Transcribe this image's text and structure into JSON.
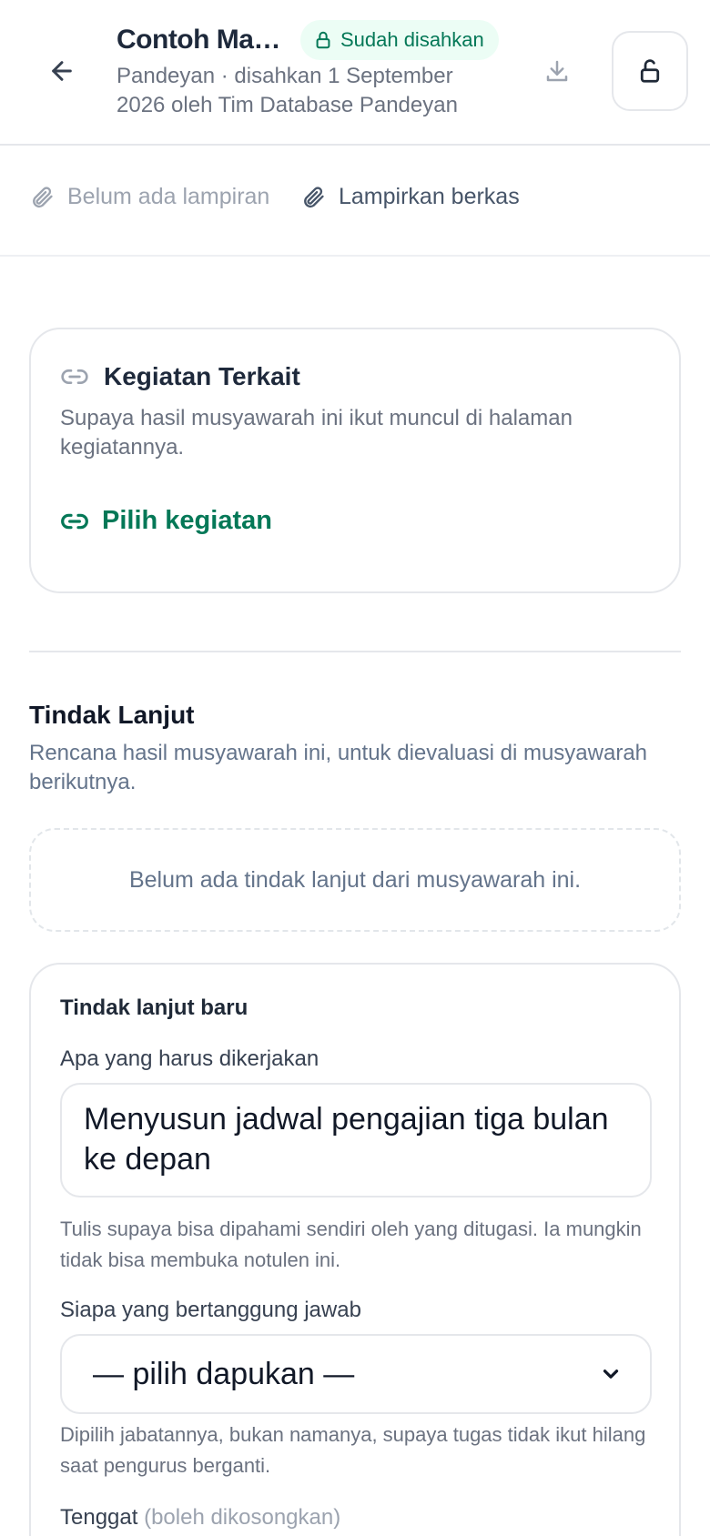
{
  "header": {
    "title": "Contoh Ma…",
    "status_badge": "Sudah disahkan",
    "subtitle": "Pandeyan · disahkan 1 September 2026 oleh Tim Database Pandeyan",
    "icons": {
      "back": "arrow-left-icon",
      "badge": "lock-icon",
      "download": "download-icon",
      "unlock": "unlock-icon"
    }
  },
  "attachments": {
    "empty_text": "Belum ada lampiran",
    "attach_label": "Lampirkan berkas",
    "icon": "paperclip-icon"
  },
  "related_activity": {
    "title": "Kegiatan Terkait",
    "description": "Supaya hasil musyawarah ini ikut muncul di halaman kegiatannya.",
    "pick_label": "Pilih kegiatan",
    "icon": "link-icon"
  },
  "follow_up": {
    "title": "Tindak Lanjut",
    "description": "Rencana hasil musyawarah ini, untuk dievaluasi di musyawarah berikutnya.",
    "empty_text": "Belum ada tindak lanjut dari musyawarah ini."
  },
  "new_follow_up": {
    "title": "Tindak lanjut baru",
    "what_label": "Apa yang harus dikerjakan",
    "what_value": "Menyusun jadwal pengajian tiga bulan ke depan",
    "what_help": "Tulis supaya bisa dipahami sendiri oleh yang ditugasi. Ia mungkin tidak bisa membuka notulen ini.",
    "who_label": "Siapa yang bertanggung jawab",
    "who_selected": "— pilih dapukan —",
    "who_help": "Dipilih jabatannya, bukan namanya, supaya tugas tidak ikut hilang saat pengurus berganti.",
    "deadline_label": "Tenggat",
    "deadline_optional": "(boleh dikosongkan)"
  },
  "colors": {
    "accent": "#047857",
    "badge_bg": "#ecfdf5",
    "border": "#e5e7eb",
    "muted_text": "#6b7280"
  }
}
